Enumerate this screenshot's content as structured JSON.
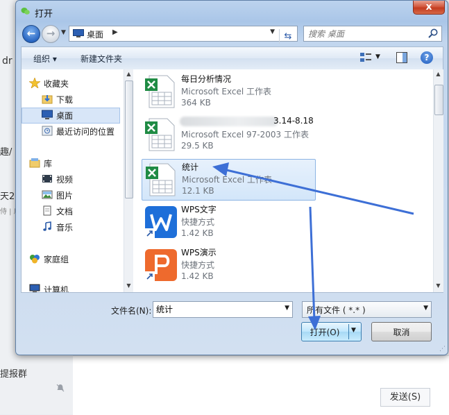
{
  "background_app": {
    "left_fragments": [
      "dr",
      "趣/",
      "天2",
      "侍 | 肩",
      "提报群"
    ],
    "send_button": "发送(S)"
  },
  "dialog": {
    "title": "打开",
    "close_label": "x",
    "address": {
      "location": "桌面",
      "search_placeholder": "搜索 桌面"
    },
    "toolbar": {
      "organize": "组织 ▾",
      "new_folder": "新建文件夹",
      "help": "?"
    },
    "nav": {
      "items": [
        {
          "label": "收藏夹",
          "icon": "star-icon"
        },
        {
          "label": "下载",
          "icon": "download-folder-icon"
        },
        {
          "label": "桌面",
          "icon": "desktop-icon",
          "selected": true
        },
        {
          "label": "最近访问的位置",
          "icon": "recent-places-icon"
        },
        {
          "label": "库",
          "icon": "library-icon"
        },
        {
          "label": "视频",
          "icon": "video-icon"
        },
        {
          "label": "图片",
          "icon": "pictures-icon"
        },
        {
          "label": "文档",
          "icon": "documents-icon"
        },
        {
          "label": "音乐",
          "icon": "music-icon"
        },
        {
          "label": "家庭组",
          "icon": "homegroup-icon"
        },
        {
          "label": "计算机",
          "icon": "computer-icon"
        }
      ]
    },
    "files": [
      {
        "name": "每日分析情况",
        "type": "Microsoft Excel 工作表",
        "size": "364 KB",
        "icon": "excel-icon"
      },
      {
        "name": "3.14-8.18",
        "type": "Microsoft Excel 97-2003 工作表",
        "size": "29.5 KB",
        "icon": "excel-icon",
        "name_partially_obscured": true
      },
      {
        "name": "统计",
        "type": "Microsoft Excel 工作表",
        "size": "12.1 KB",
        "icon": "excel-icon",
        "selected": true
      },
      {
        "name": "WPS文字",
        "type": "快捷方式",
        "size": "1.42 KB",
        "icon": "wps-writer-icon"
      },
      {
        "name": "WPS演示",
        "type": "快捷方式",
        "size": "1.42 KB",
        "icon": "wps-presentation-icon"
      }
    ],
    "footer": {
      "filename_label": "文件名(N):",
      "filename_value": "统计",
      "filetype_value": "所有文件 ( *.* )",
      "open_button": "打开(O)",
      "cancel_button": "取消"
    },
    "annotation_color": "#3d6fd6"
  }
}
